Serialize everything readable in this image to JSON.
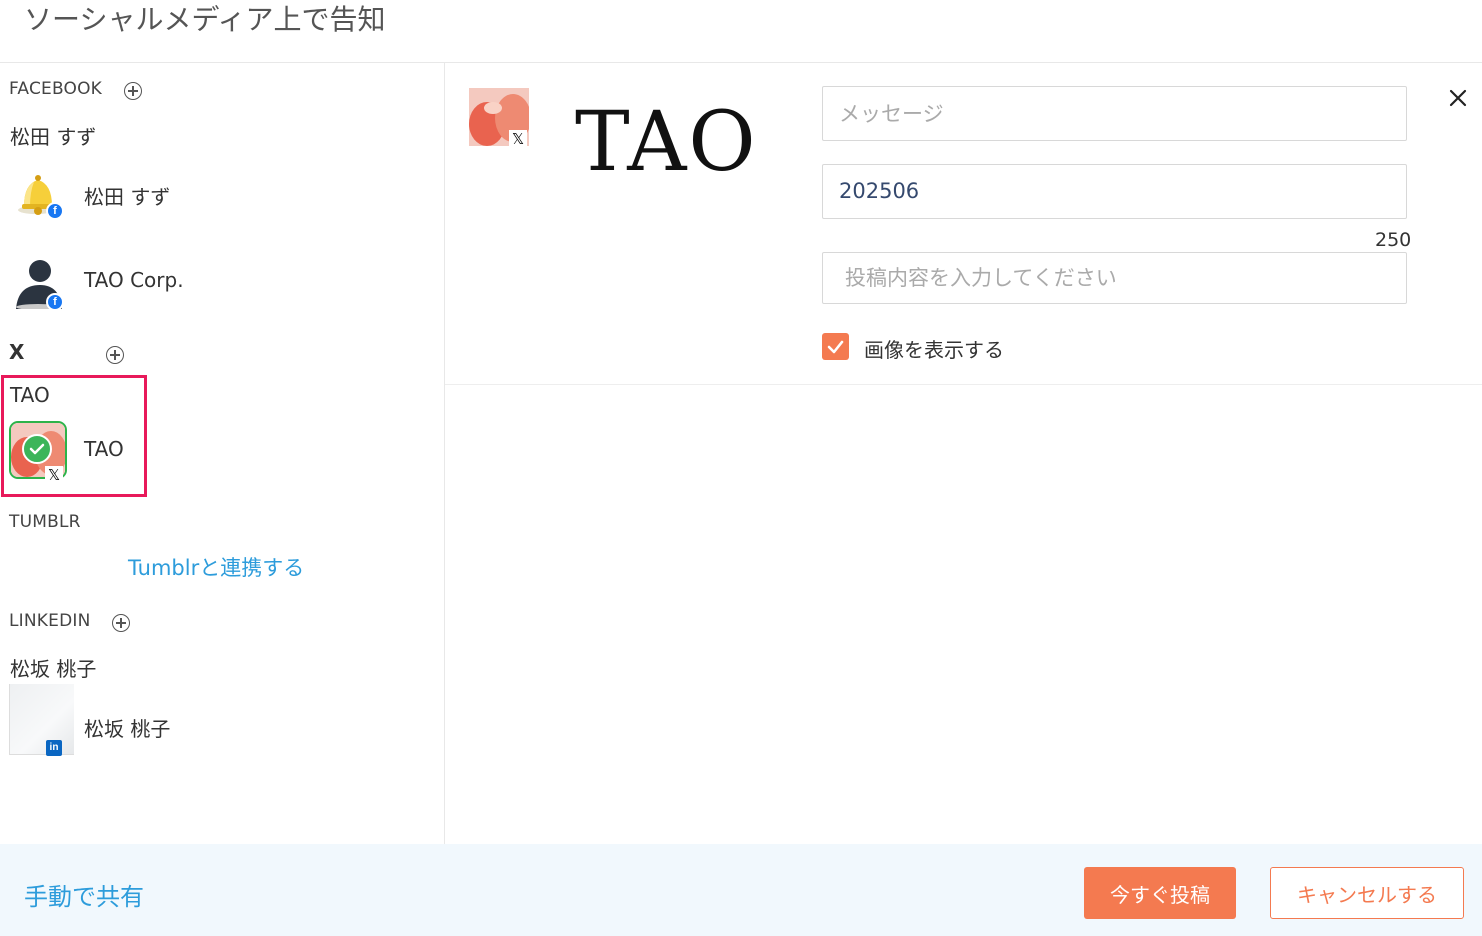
{
  "dialog": {
    "title": "ソーシャルメディア上で告知"
  },
  "sidebar": {
    "facebook": {
      "header": "FACEBOOK",
      "account_name": "松田 すず",
      "items": [
        {
          "label": "松田 すず",
          "avatar": "bell-icon",
          "network": "facebook"
        },
        {
          "label": "TAO Corp.",
          "avatar": "person-silhouette-icon",
          "network": "facebook"
        }
      ]
    },
    "x": {
      "header": "X",
      "account_name": "TAO",
      "items": [
        {
          "label": "TAO",
          "avatar": "peach-photo",
          "network": "x",
          "selected": true
        }
      ]
    },
    "tumblr": {
      "header": "TUMBLR",
      "connect_link": "Tumblrと連携する"
    },
    "linkedin": {
      "header": "LINKEDIN",
      "account_name": "松坂 桃子",
      "items": [
        {
          "label": "松坂 桃子",
          "avatar": "blurred-photo",
          "network": "linkedin"
        }
      ]
    }
  },
  "preview": {
    "logo_text": "TAO",
    "message_placeholder": "メッセージ",
    "title_value": "202506",
    "char_counter": "250",
    "content_placeholder": "投稿内容を入力してください",
    "show_image_label": "画像を表示する",
    "show_image_checked": true
  },
  "footer": {
    "manual_share": "手動で共有",
    "post_now": "今すぐ投稿",
    "cancel": "キャンセルする"
  },
  "colors": {
    "accent_orange": "#f47a50",
    "link_blue": "#2d9cdb",
    "highlight_pink": "#e8195a",
    "selected_green": "#2db34a",
    "footer_bg": "#f1f8fd"
  }
}
